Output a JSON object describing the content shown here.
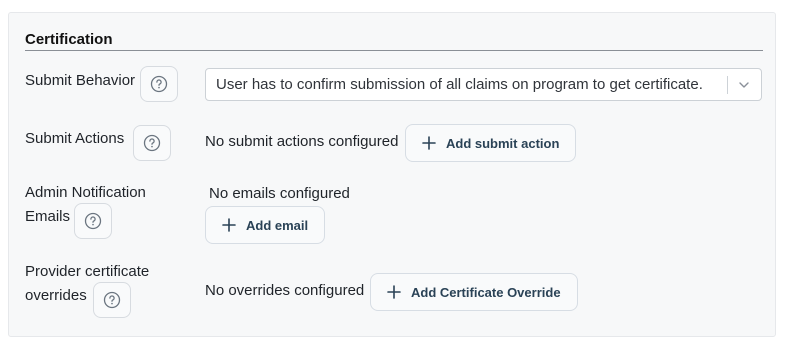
{
  "section": {
    "title": "Certification"
  },
  "submit_behavior": {
    "label": "Submit Behavior",
    "selected": "User has to confirm submission of all claims on program to get certificate."
  },
  "submit_actions": {
    "label": "Submit Actions",
    "empty_text": "No submit actions configured",
    "button": "Add submit action"
  },
  "admin_emails": {
    "label_line1": "Admin Notification",
    "label_line2": "Emails",
    "empty_text": "No emails configured",
    "button": "Add email"
  },
  "overrides": {
    "label_line1": "Provider certificate",
    "label_line2": "overrides",
    "empty_text": "No overrides configured",
    "button": "Add Certificate Override"
  },
  "icons": {
    "help": "help-circle-icon",
    "add": "plus-icon",
    "dropdown": "chevron-down-icon"
  },
  "colors": {
    "panel_bg": "#f7f8f9",
    "button_text": "#2a4256",
    "border": "#d7dde4"
  }
}
